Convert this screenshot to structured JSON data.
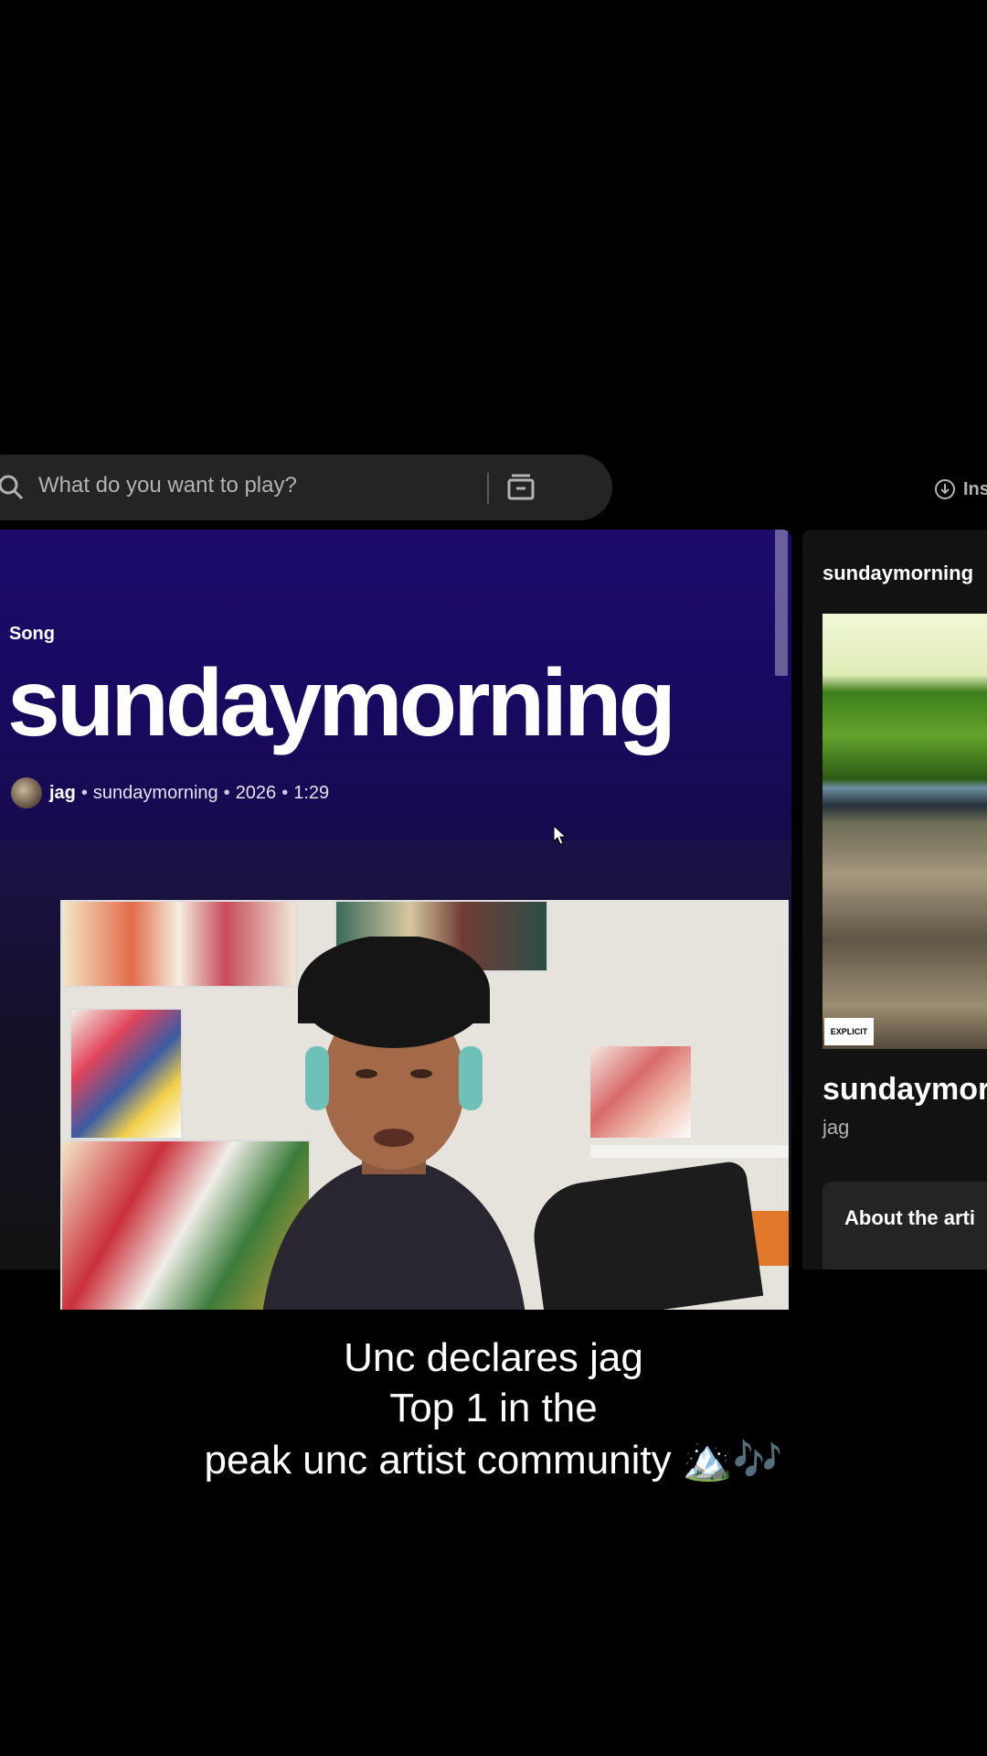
{
  "search": {
    "placeholder": "What do you want to play?"
  },
  "header": {
    "install_label": "Ins"
  },
  "song": {
    "type_label": "Song",
    "title": "sundaymorning",
    "artist": "jag",
    "album": "sundaymorning",
    "year": "2026",
    "duration": "1:29"
  },
  "now_playing": {
    "panel_title": "sundaymorning",
    "track_title": "sundaymor",
    "artist": "jag",
    "about_label": "About the arti"
  },
  "caption": {
    "line1": "Unc declares jag",
    "line2": "Top 1 in the",
    "line3": "peak unc artist community 🏔️🎶"
  },
  "colors": {
    "hero_bg": "#1d0a6b",
    "app_bg": "#121212",
    "search_bg": "#242424"
  }
}
